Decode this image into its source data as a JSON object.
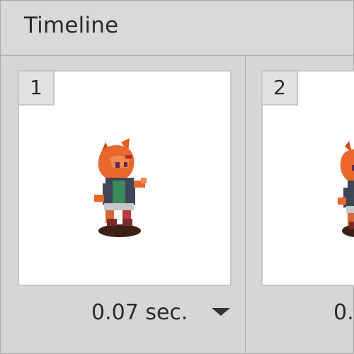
{
  "panel": {
    "title": "Timeline"
  },
  "frames": [
    {
      "number": "1",
      "delay": "0.07 sec."
    },
    {
      "number": "2",
      "delay": "0."
    }
  ],
  "icons": {
    "delay_menu": "chevron-down-icon"
  },
  "colors": {
    "panel_bg": "#d6d6d6",
    "frame_bg": "#ffffff",
    "text": "#2b2b2b"
  }
}
